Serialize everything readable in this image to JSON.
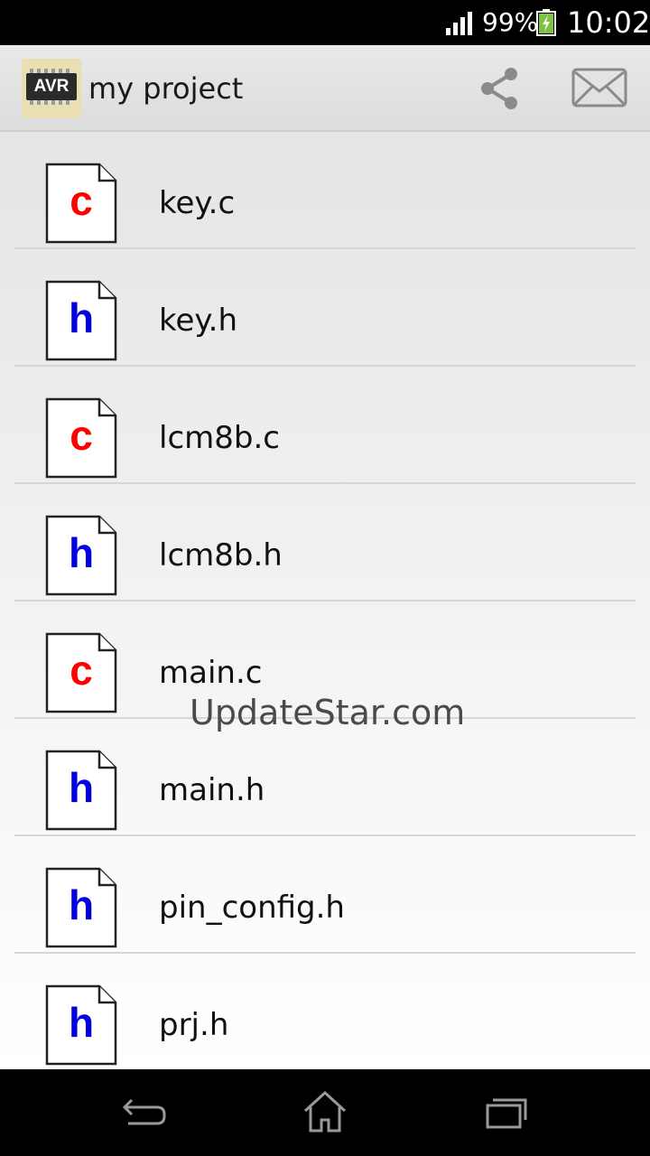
{
  "status_bar": {
    "battery_percent": "99%",
    "time": "10:02",
    "icons": [
      "signal-icon",
      "battery-charging-icon"
    ]
  },
  "action_bar": {
    "app_icon_label": "AVR",
    "title": "my project",
    "icons": [
      "share-icon",
      "mail-icon"
    ]
  },
  "files": [
    {
      "name": "key.c",
      "type": "c"
    },
    {
      "name": "key.h",
      "type": "h"
    },
    {
      "name": "lcm8b.c",
      "type": "c"
    },
    {
      "name": "lcm8b.h",
      "type": "h"
    },
    {
      "name": "main.c",
      "type": "c"
    },
    {
      "name": "main.h",
      "type": "h"
    },
    {
      "name": "pin_config.h",
      "type": "h"
    },
    {
      "name": "prj.h",
      "type": "h"
    }
  ],
  "watermark": "UpdateStar.com",
  "navigation": {
    "icons": [
      "back-icon",
      "home-icon",
      "recent-apps-icon"
    ]
  },
  "colors": {
    "c_file": "#ff0000",
    "h_file": "#0000e0",
    "action_bar": "#e2e2e2"
  }
}
